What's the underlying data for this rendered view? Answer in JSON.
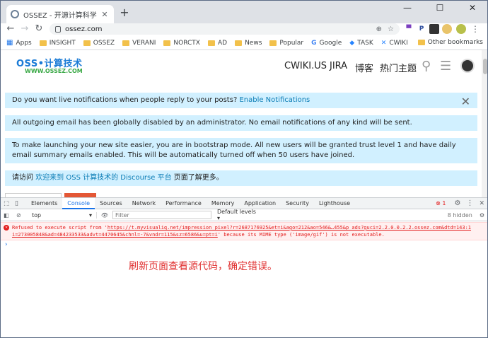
{
  "browser": {
    "tab_title": "OSSEZ - 开源计算科学",
    "url": "ossez.com",
    "window_controls": [
      "—",
      "☐",
      "✕"
    ],
    "bookmarks": [
      {
        "label": "Apps",
        "icon": "apps-grid-icon"
      },
      {
        "label": "INSIGHT",
        "icon": "folder-icon"
      },
      {
        "label": "OSSEZ",
        "icon": "folder-icon"
      },
      {
        "label": "VERANI",
        "icon": "folder-icon"
      },
      {
        "label": "NORCTX",
        "icon": "folder-icon"
      },
      {
        "label": "AD",
        "icon": "folder-icon"
      },
      {
        "label": "News",
        "icon": "folder-icon"
      },
      {
        "label": "Popular",
        "icon": "folder-icon"
      },
      {
        "label": "Google",
        "icon": "google-icon"
      },
      {
        "label": "TASK",
        "icon": "diamond-icon"
      },
      {
        "label": "CWIKI",
        "icon": "confluence-icon"
      }
    ],
    "other_bookmarks": "Other bookmarks"
  },
  "site": {
    "logo_main": "OSS•计算技术",
    "logo_sub": "WWW.OSSEZ.COM",
    "nav": [
      "CWIKI.US",
      "JIRA",
      "博客",
      "热门主题"
    ]
  },
  "banners": {
    "notify_text": "Do you want live notifications when people reply to your posts?",
    "notify_link": "Enable Notifications",
    "email_disabled": "All outgoing email has been globally disabled by an administrator. No email notifications of any kind will be sent.",
    "bootstrap": "To make launching your new site easier, you are in bootstrap mode. All new users will be granted trust level 1 and have daily email summary emails enabled. This will be automatically turned off when 50 users have joined.",
    "welcome_prefix": "请访问",
    "welcome_link": "欢迎来到 OSS 计算技术的 Discourse 平台",
    "welcome_suffix": "页面了解更多。"
  },
  "devtools": {
    "tabs": [
      "Elements",
      "Console",
      "Sources",
      "Network",
      "Performance",
      "Memory",
      "Application",
      "Security",
      "Lighthouse"
    ],
    "active_tab": "Console",
    "error_count": "1",
    "context": "top",
    "filter_placeholder": "Filter",
    "levels": "Default levels",
    "hidden": "8 hidden",
    "error_prefix": "Refused to execute script from '",
    "error_url": "https://t.myvisualiq.net/impression_pixel?r=2687176925&et=i&ago=212&ao=546&…455&p ads?guci=2.2.0.0.2.2.ossez.com&dtd=143:1 i=273005848&ad=484233533&advt=4470645&chnl=-7&vndr=115&sz=6586&u=pt=i",
    "error_suffix": "' because its MIME type ('image/gif') is not executable.",
    "prompt": "›"
  },
  "annotation": "刷新页面查看源代码，确定错误。"
}
